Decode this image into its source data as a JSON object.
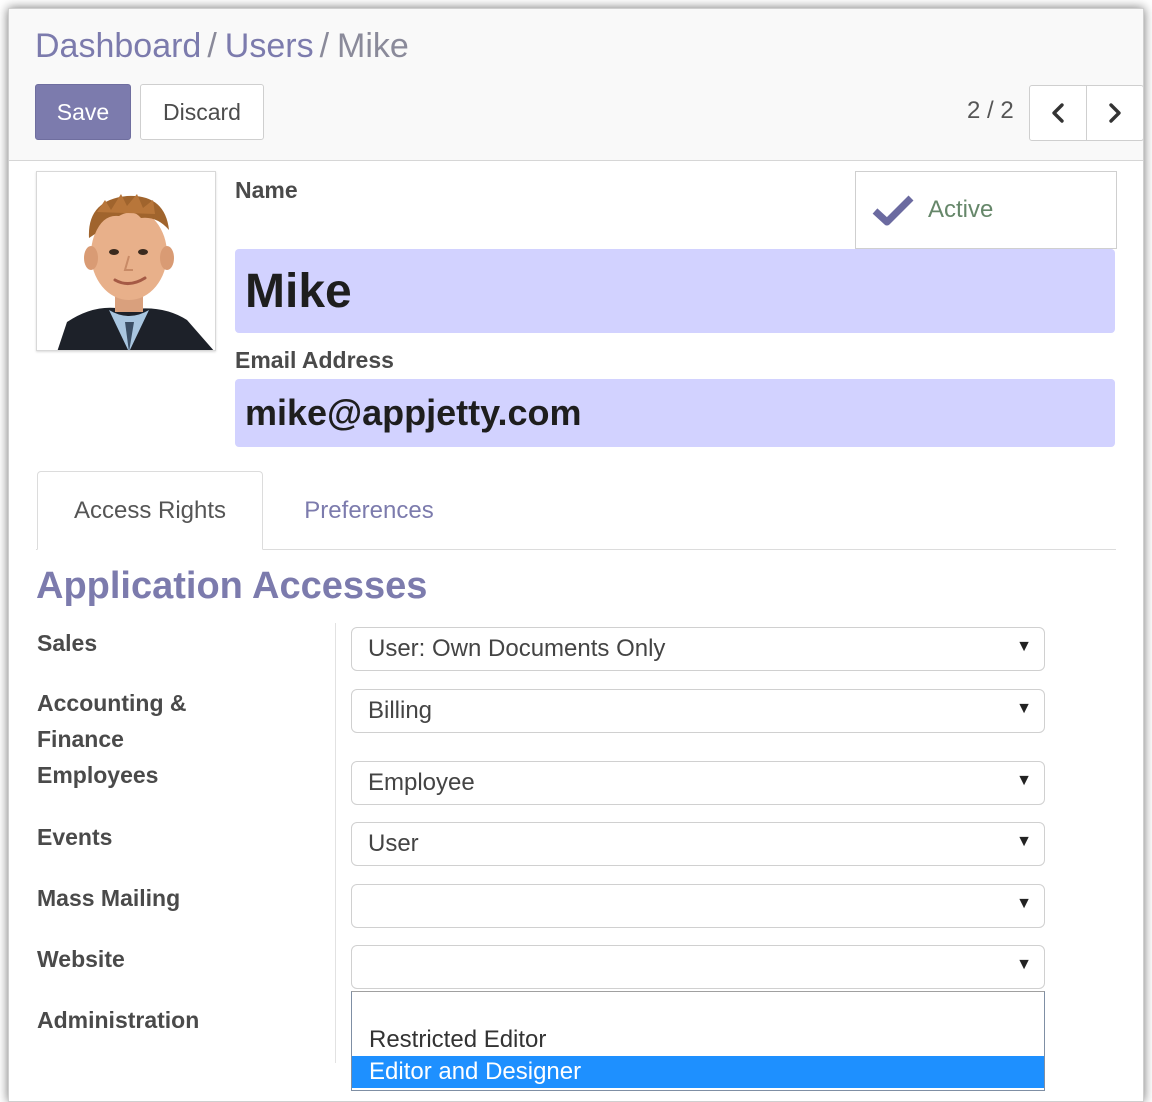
{
  "breadcrumb": {
    "items": [
      "Dashboard",
      "Users",
      "Mike"
    ],
    "separator": "/"
  },
  "toolbar": {
    "save_label": "Save",
    "discard_label": "Discard"
  },
  "pager": {
    "value": "2 / 2"
  },
  "user": {
    "name_label": "Name",
    "name": "Mike",
    "email_label": "Email Address",
    "email": "mike@appjetty.com",
    "active_label": "Active",
    "active": true,
    "photo_icon": "user-photo"
  },
  "tabs": [
    {
      "label": "Access Rights",
      "active": true
    },
    {
      "label": "Preferences",
      "active": false
    }
  ],
  "section_title": "Application Accesses",
  "accesses": [
    {
      "label": "Sales",
      "value": "User: Own Documents Only"
    },
    {
      "label": "Accounting & Finance",
      "value": "Billing"
    },
    {
      "label": "Employees",
      "value": "Employee"
    },
    {
      "label": "Events",
      "value": "User"
    },
    {
      "label": "Mass Mailing",
      "value": ""
    },
    {
      "label": "Website",
      "value": ""
    },
    {
      "label": "Administration",
      "value": ""
    }
  ],
  "website_dropdown": {
    "options": [
      "",
      "Restricted Editor",
      "Editor and Designer"
    ],
    "highlighted": "Editor and Designer"
  },
  "colors": {
    "primary": "#7c7bad",
    "input_highlight": "#d2d2ff",
    "dropdown_highlight": "#1e90ff",
    "active_text": "#66876a"
  }
}
